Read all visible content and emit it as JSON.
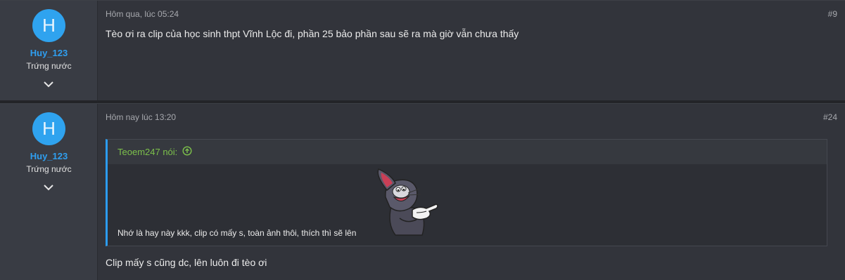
{
  "posts": [
    {
      "avatar_letter": "H",
      "username": "Huy_123",
      "user_title": "Trứng nước",
      "date": "Hôm qua, lúc 05:24",
      "number": "#9",
      "message": "Tèo ơi ra clip của học sinh thpt Vĩnh Lộc đi, phần 25 bảo phần sau sẽ ra mà giờ vẫn chưa thấy"
    },
    {
      "avatar_letter": "H",
      "username": "Huy_123",
      "user_title": "Trứng nước",
      "date": "Hôm nay lúc 13:20",
      "number": "#24",
      "quote": {
        "author": "Teoem247 nói:",
        "text": "Nhớ là hay này kkk, clip có mấy s, toàn ảnh thôi, thích thì sẽ lên"
      },
      "message": "Clip mấy s cũng dc, lên luôn đi tèo ơi"
    }
  ],
  "colors": {
    "accent": "#2f9ff0",
    "quote_author": "#7cc04b",
    "background": "#32343b"
  },
  "icons": [
    "chevron-down-icon",
    "arrow-up-circle-icon",
    "cat-sticker"
  ]
}
